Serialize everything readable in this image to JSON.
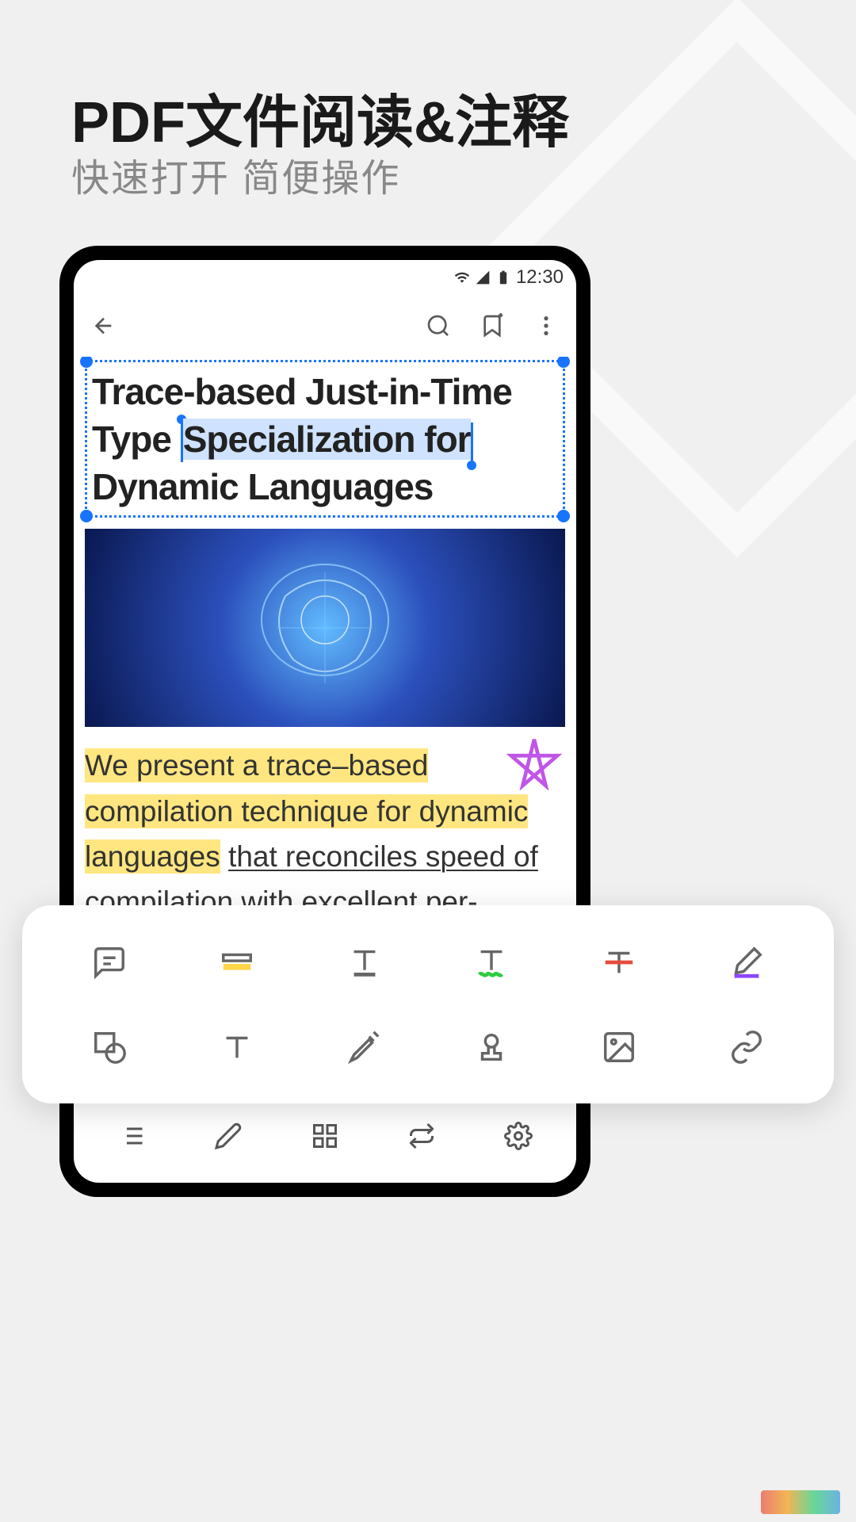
{
  "page": {
    "title": "PDF文件阅读&注释",
    "subtitle": "快速打开 简便操作"
  },
  "status": {
    "time": "12:30"
  },
  "document": {
    "title_part1": "Trace-based Just-in-Time Type ",
    "title_selected": "Specialization for",
    "title_part3": " Dynamic Languages",
    "body_hl1": "We present a trace–based compilation technique for dynamic languages",
    "body_plain1": " ",
    "body_ul1": "that reconciles speed of",
    "body_plain2": " compilation with excellent per-"
  },
  "tools": {
    "row1": [
      "comment",
      "highlight",
      "underline-t",
      "squiggly",
      "strikeout",
      "ink"
    ],
    "row2": [
      "shape",
      "text",
      "signature",
      "stamp",
      "image",
      "link"
    ]
  },
  "bottom_nav": [
    "outline",
    "edit",
    "thumbnails",
    "rotate",
    "settings"
  ]
}
